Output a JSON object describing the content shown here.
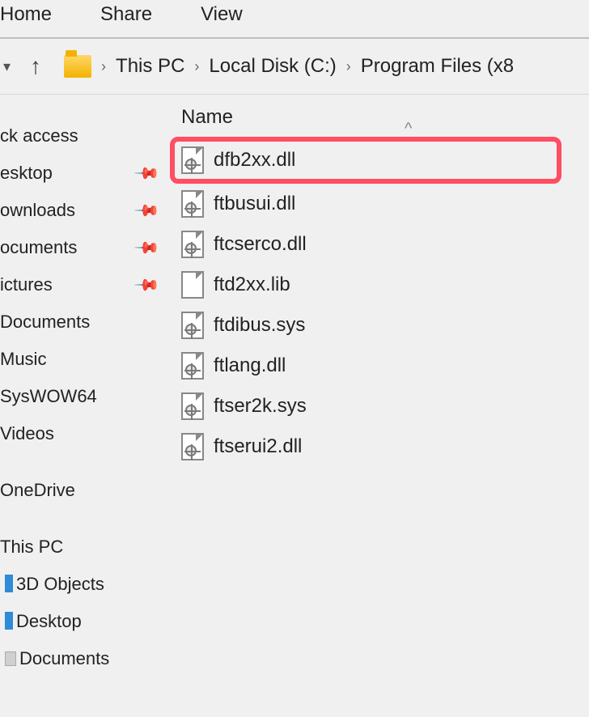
{
  "menubar": {
    "home": "Home",
    "share": "Share",
    "view": "View"
  },
  "breadcrumb": {
    "items": [
      "This PC",
      "Local Disk (C:)",
      "Program Files (x8"
    ]
  },
  "columns": {
    "name": "Name"
  },
  "sidebar": {
    "quick_access": "ck access",
    "desktop": "esktop",
    "downloads": "ownloads",
    "documents": "ocuments",
    "pictures": "ictures",
    "documents2": "Documents",
    "music": "Music",
    "syswow64": "SysWOW64",
    "videos": "Videos",
    "onedrive": "OneDrive",
    "this_pc": "This PC",
    "tp_3d": "3D Objects",
    "tp_desktop": "Desktop",
    "tp_documents": "Documents"
  },
  "files": [
    {
      "name": "dfb2xx.dll",
      "icon": "gear",
      "highlight": true
    },
    {
      "name": "ftbusui.dll",
      "icon": "gear",
      "highlight": false
    },
    {
      "name": "ftcserco.dll",
      "icon": "gear",
      "highlight": false
    },
    {
      "name": "ftd2xx.lib",
      "icon": "plain",
      "highlight": false
    },
    {
      "name": "ftdibus.sys",
      "icon": "gear",
      "highlight": false
    },
    {
      "name": "ftlang.dll",
      "icon": "gear",
      "highlight": false
    },
    {
      "name": "ftser2k.sys",
      "icon": "gear",
      "highlight": false
    },
    {
      "name": "ftserui2.dll",
      "icon": "gear",
      "highlight": false
    }
  ]
}
